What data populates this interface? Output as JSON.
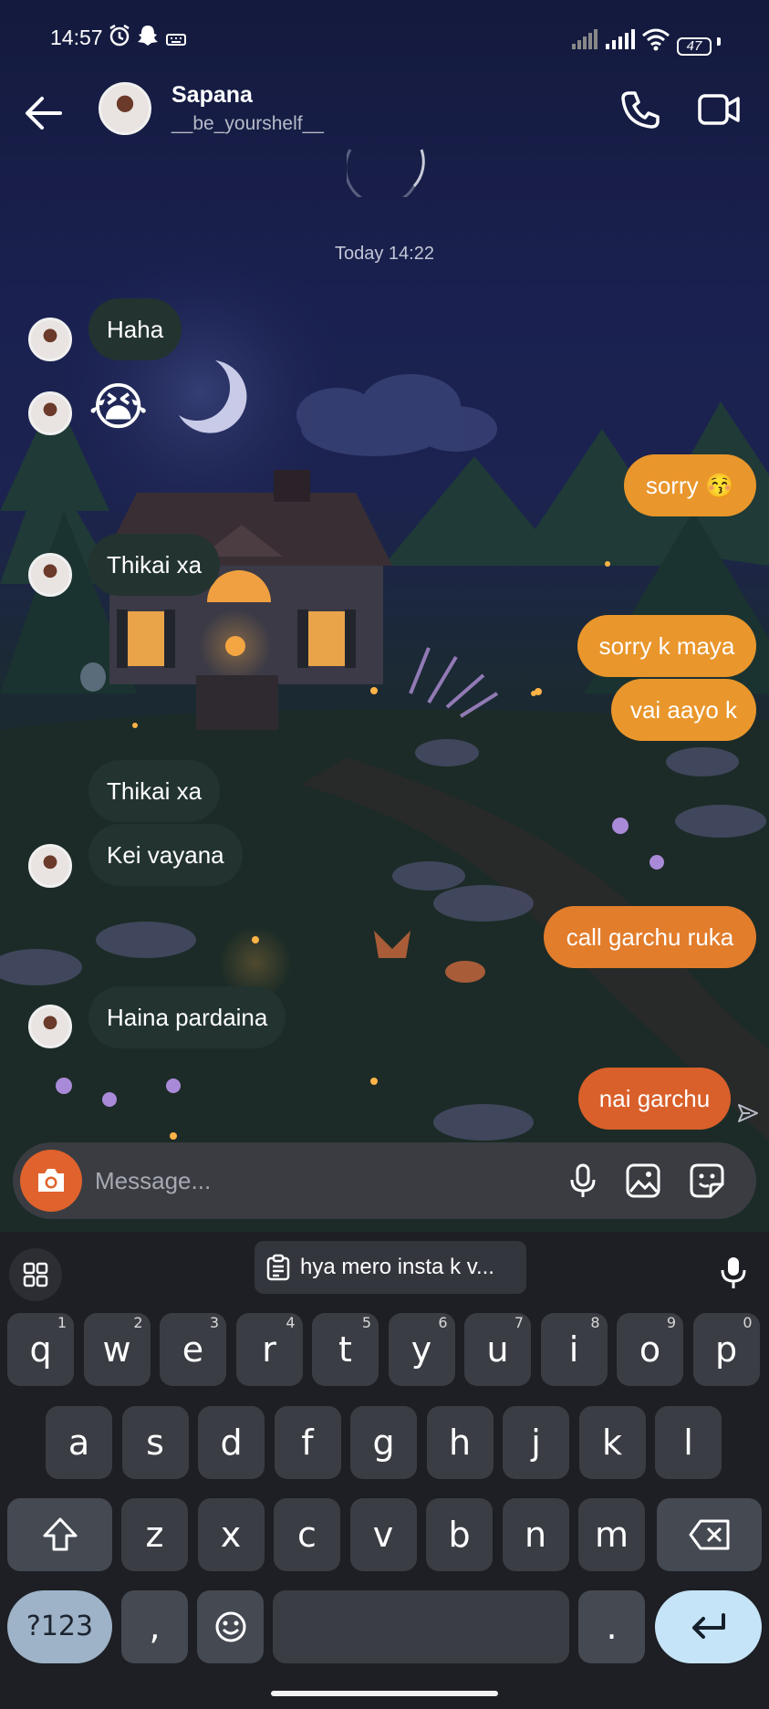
{
  "status_bar": {
    "time": "14:57",
    "battery": "47"
  },
  "header": {
    "name": "Sapana",
    "username": "__be_yourshelf__"
  },
  "chat": {
    "timestamp": "Today 14:22",
    "messages": [
      {
        "from": "them",
        "text": "Haha"
      },
      {
        "from": "them",
        "text": "😭"
      },
      {
        "from": "me",
        "text": "sorry 😚"
      },
      {
        "from": "them",
        "text": "Thikai xa"
      },
      {
        "from": "me",
        "text": "sorry k maya"
      },
      {
        "from": "me",
        "text": "vai aayo k"
      },
      {
        "from": "them",
        "text": "Thikai xa"
      },
      {
        "from": "them",
        "text": "Kei vayana"
      },
      {
        "from": "me",
        "text": "call garchu ruka"
      },
      {
        "from": "them",
        "text": "Haina pardaina"
      },
      {
        "from": "me",
        "text": "nai garchu"
      }
    ]
  },
  "composer": {
    "placeholder": "Message..."
  },
  "keyboard": {
    "suggestion": "hya mero insta k v...",
    "row1": [
      {
        "key": "q",
        "hint": "1"
      },
      {
        "key": "w",
        "hint": "2"
      },
      {
        "key": "e",
        "hint": "3"
      },
      {
        "key": "r",
        "hint": "4"
      },
      {
        "key": "t",
        "hint": "5"
      },
      {
        "key": "y",
        "hint": "6"
      },
      {
        "key": "u",
        "hint": "7"
      },
      {
        "key": "i",
        "hint": "8"
      },
      {
        "key": "o",
        "hint": "9"
      },
      {
        "key": "p",
        "hint": "0"
      }
    ],
    "row2": [
      "a",
      "s",
      "d",
      "f",
      "g",
      "h",
      "j",
      "k",
      "l"
    ],
    "row3": [
      "z",
      "x",
      "c",
      "v",
      "b",
      "n",
      "m"
    ],
    "symbols_key": "?123",
    "comma_key": ",",
    "period_key": "."
  },
  "colors": {
    "outgoing_light": "#e9962c",
    "outgoing_mid": "#e27d2c",
    "outgoing_dark": "#d9602a",
    "incoming": "#233330",
    "enter_key": "#c6e4f7",
    "symbols_key": "#9eb3c7"
  }
}
